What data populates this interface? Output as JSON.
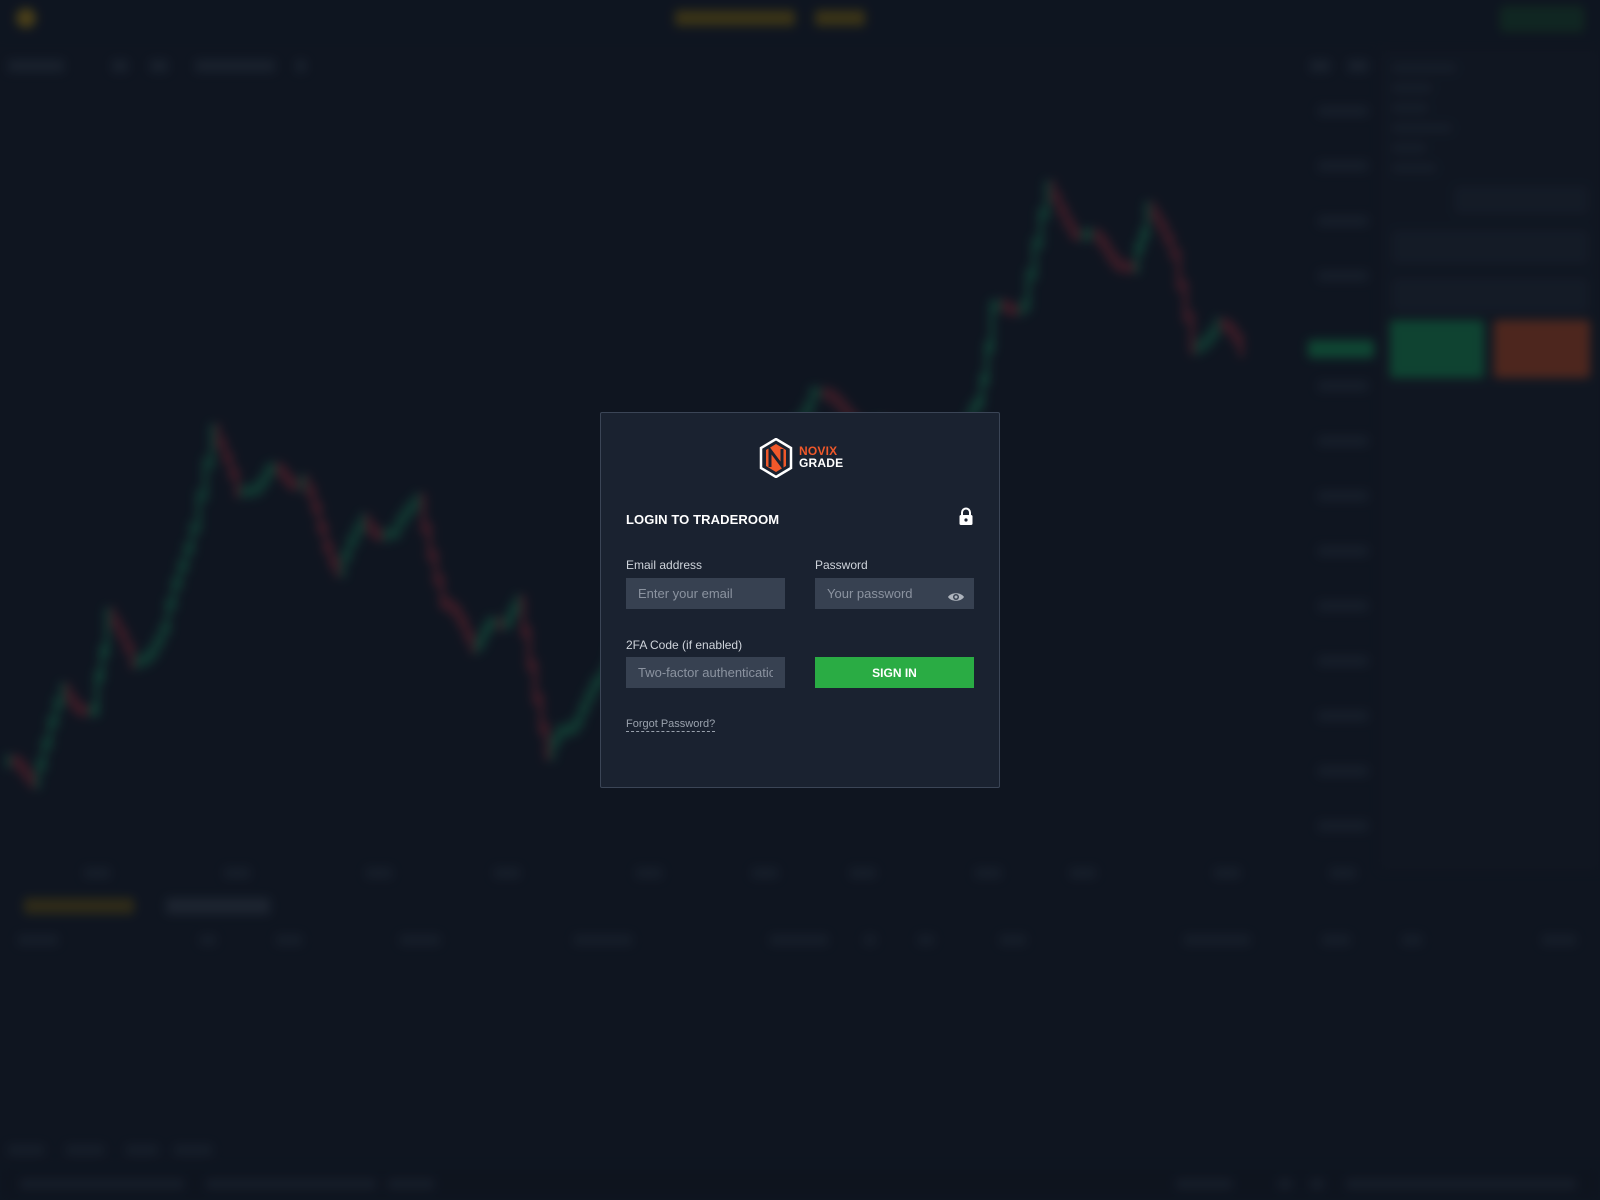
{
  "brand": {
    "name_top": "NOVIX",
    "name_bottom": "GRADE",
    "accent_color": "#f0582a"
  },
  "login": {
    "title": "LOGIN TO TRADEROOM",
    "email_label": "Email address",
    "email_placeholder": "Enter your email",
    "password_label": "Password",
    "password_placeholder": "Your password",
    "twofa_label": "2FA Code (if enabled)",
    "twofa_placeholder": "Two-factor authentication code",
    "signin_label": "SIGN IN",
    "signin_color": "#2aac44",
    "forgot_label": "Forgot Password?"
  },
  "icons": {
    "lock": "lock-icon",
    "eye": "eye-icon",
    "logo": "novix-grade-logo-icon"
  },
  "background": {
    "buy_color": "#139a57",
    "sell_color": "#c14b22",
    "candle_up_color": "#1fa36a",
    "candle_down_color": "#c0343f"
  }
}
